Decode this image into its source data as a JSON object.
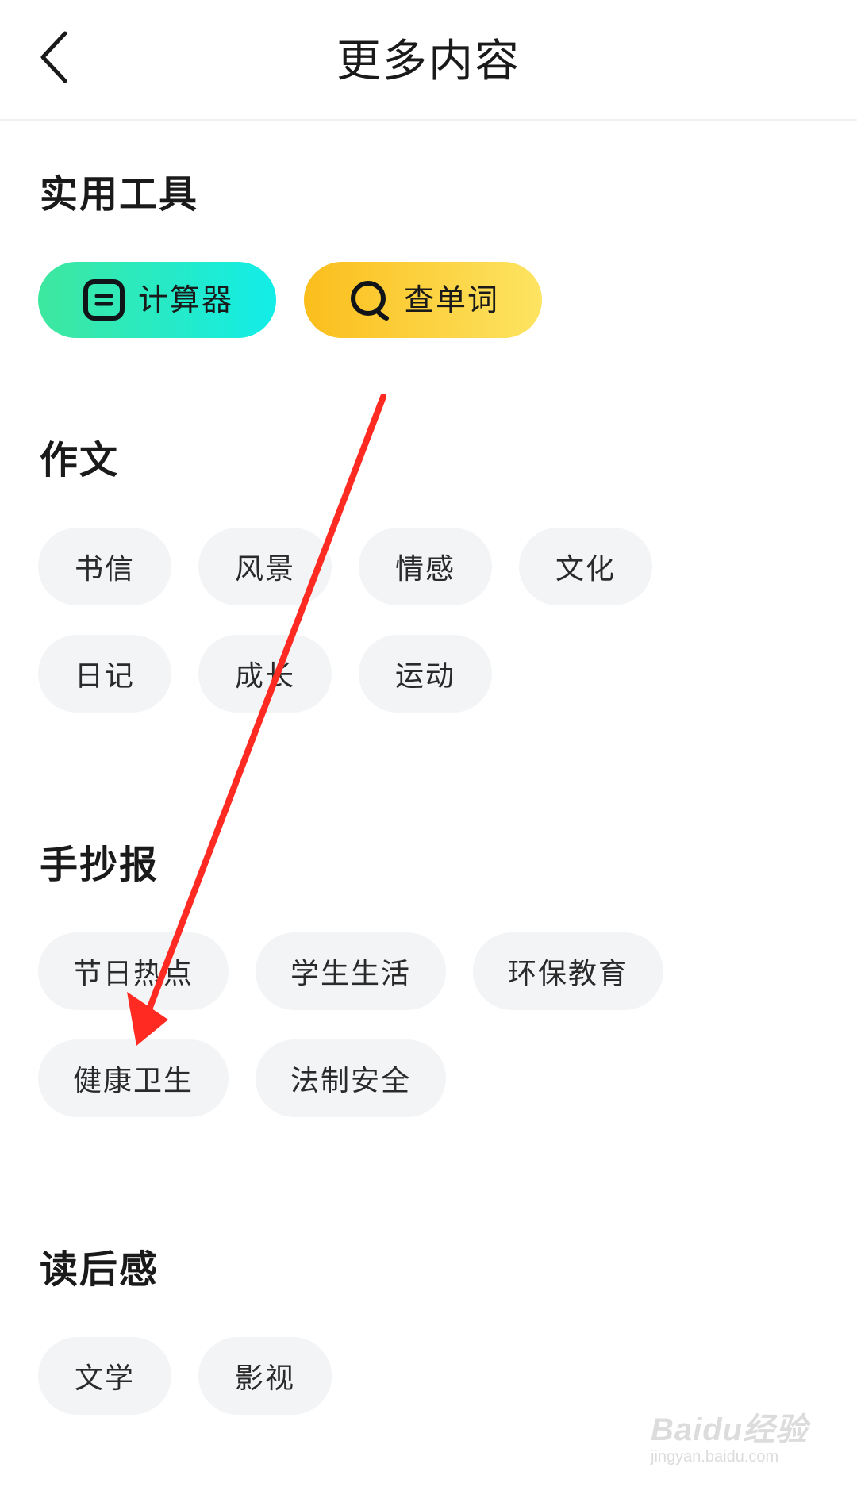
{
  "header": {
    "title": "更多内容",
    "back_icon": "chevron-left-icon"
  },
  "tools": {
    "title": "实用工具",
    "items": [
      {
        "label": "计算器",
        "icon": "calculator-icon",
        "colors": [
          "#3ee79e",
          "#12ede8"
        ]
      },
      {
        "label": "查单词",
        "icon": "search-word-icon",
        "colors": [
          "#fbbe1c",
          "#fde462"
        ]
      }
    ]
  },
  "essay": {
    "title": "作文",
    "tags": [
      "书信",
      "风景",
      "情感",
      "文化",
      "日记",
      "成长",
      "运动"
    ]
  },
  "handcopy": {
    "title": "手抄报",
    "tags": [
      "节日热点",
      "学生生活",
      "环保教育",
      "健康卫生",
      "法制安全"
    ]
  },
  "reading": {
    "title": "读后感",
    "tags": [
      "文学",
      "影视"
    ]
  },
  "annotation": {
    "arrow_color": "#ff2a22"
  },
  "watermark": {
    "logo": "Baidu经验",
    "url": "jingyan.baidu.com"
  }
}
